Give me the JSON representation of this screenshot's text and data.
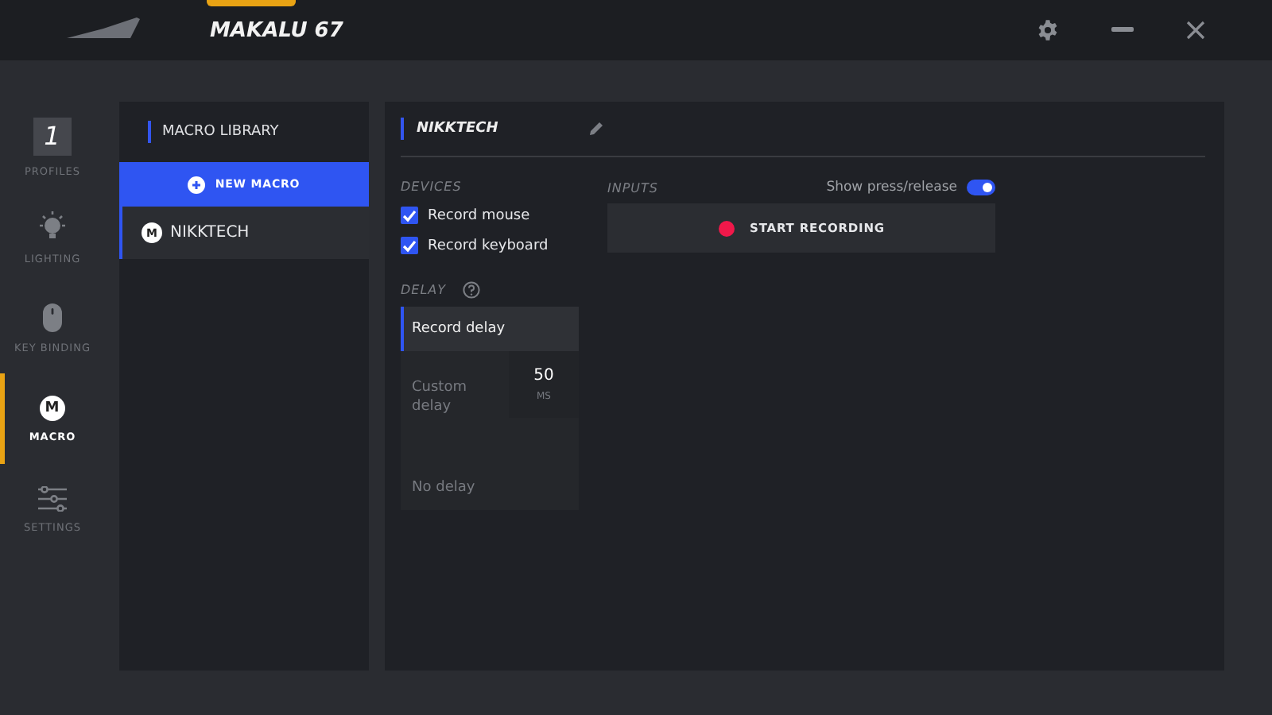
{
  "window": {
    "title": "MAKALU 67"
  },
  "nav": [
    {
      "kind": "profile",
      "label": "PROFILES",
      "value": "1",
      "selected": false
    },
    {
      "kind": "bulb",
      "label": "LIGHTING",
      "selected": false
    },
    {
      "kind": "mouse",
      "label": "KEY BINDING",
      "selected": false
    },
    {
      "kind": "macro",
      "label": "MACRO",
      "badge": "M",
      "selected": true
    },
    {
      "kind": "sliders",
      "label": "SETTINGS",
      "selected": false
    }
  ],
  "library": {
    "title": "MACRO LIBRARY",
    "new_button": "NEW MACRO",
    "items": [
      {
        "badge": "M",
        "name": "NIKKTECH",
        "selected": true
      }
    ]
  },
  "editor": {
    "name": "NIKKTECH",
    "devices_label": "DEVICES",
    "devices": [
      {
        "label": "Record mouse",
        "checked": true
      },
      {
        "label": "Record keyboard",
        "checked": true
      }
    ],
    "delay_label": "DELAY",
    "delay_options": [
      {
        "kind": "plain",
        "label": "Record delay",
        "selected": true
      },
      {
        "kind": "custom",
        "label": "Custom delay",
        "value": "50",
        "unit": "MS",
        "selected": false
      },
      {
        "kind": "plain",
        "label": "No delay",
        "selected": false
      }
    ],
    "inputs_label": "INPUTS",
    "show_press_release": {
      "label": "Show press/release",
      "on": true
    },
    "record_button": "START RECORDING"
  }
}
